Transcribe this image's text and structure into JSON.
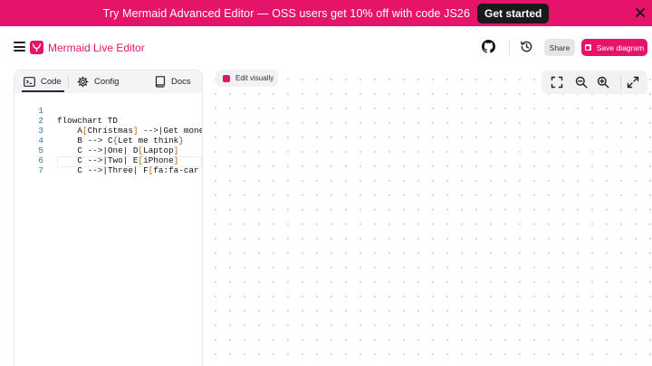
{
  "banner": {
    "text": "Try Mermaid Advanced Editor — OSS users get 10% off with code JS26",
    "cta": "Get started",
    "bg_color": "#e5136a"
  },
  "header": {
    "title": "Mermaid Live Editor",
    "share_label": "Share",
    "save_label": "Save diagram",
    "icons": [
      "menu-icon",
      "mermaid-logo",
      "github-icon",
      "history-icon"
    ]
  },
  "tabs": [
    {
      "label": "Code",
      "icon": "code-icon",
      "active": true
    },
    {
      "label": "Config",
      "icon": "gear-icon",
      "active": false
    },
    {
      "label": "Docs",
      "icon": "book-icon",
      "active": false
    }
  ],
  "editor": {
    "lines": [
      {
        "n": "1",
        "text": "flowchart TD"
      },
      {
        "n": "2",
        "text": "    A[Christmas] -->|Get money|"
      },
      {
        "n": "3",
        "text": "    B --> C{Let me think}"
      },
      {
        "n": "4",
        "text": "    C -->|One| D[Laptop]"
      },
      {
        "n": "5",
        "text": "    C -->|Two| E[iPhone]"
      },
      {
        "n": "6",
        "text": "    C -->|Three| F[fa:fa-car Car"
      },
      {
        "n": "7",
        "text": ""
      }
    ]
  },
  "canvas": {
    "edit_visually_label": "Edit visually",
    "toolbar_icons": [
      "fullscreen-icon",
      "zoom-out-icon",
      "zoom-in-icon",
      "expand-icon"
    ]
  },
  "colors": {
    "accent": "#e5136a",
    "line_number": "#237893",
    "bracket": "#c25a00"
  }
}
